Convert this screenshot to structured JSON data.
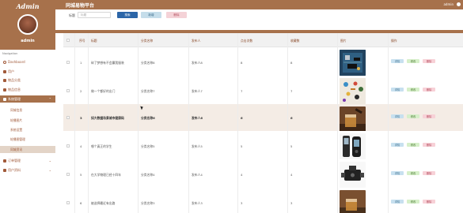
{
  "brand": "Admin",
  "header": {
    "title": "同城易物平台",
    "user": "admin"
  },
  "sidebar": {
    "admin_name": "admin",
    "nav_title": "Navigation",
    "items": [
      {
        "label": "Dashboard",
        "icon": "dashboard-icon"
      },
      {
        "label": "用户",
        "icon": "user-icon"
      },
      {
        "label": "物品分类",
        "icon": "category-icon"
      },
      {
        "label": "物品信息",
        "icon": "goods-icon"
      },
      {
        "label": "系统管理",
        "icon": "system-icon"
      },
      {
        "label": "订单管理",
        "icon": "order-icon"
      },
      {
        "label": "用户资料",
        "icon": "profile-icon"
      }
    ],
    "subitems": [
      "同城信息",
      "轮播图片",
      "系统设置",
      "轮播图管理",
      "同城资讯"
    ]
  },
  "search": {
    "label": "标题",
    "placeholder": "标题",
    "search_btn": "搜索",
    "add_btn": "新增",
    "delete_btn": "删除"
  },
  "table": {
    "headers": [
      "序号",
      "标题",
      "分类名称",
      "发布人",
      "点击次数",
      "收藏数",
      "图片",
      "操作"
    ],
    "rows": [
      {
        "no": "1",
        "title": "碎了梦想有不会赢我服装",
        "category": "分类名称8",
        "publisher": "发布人8",
        "clicks": "8",
        "favs": "8",
        "image": "circuit-board"
      },
      {
        "no": "2",
        "title": "做一个都好的出门",
        "category": "分类名称7",
        "publisher": "发布人7",
        "clicks": "7",
        "favs": "7",
        "image": "electronic-components"
      },
      {
        "no": "3",
        "title": "如大数据场景城市健康码",
        "category": "分类名称6",
        "publisher": "发布人6",
        "clicks": "6",
        "favs": "6",
        "image": "whisky-glass"
      },
      {
        "no": "4",
        "title": "哪个真正的学生",
        "category": "分类名称5",
        "publisher": "发布人5",
        "clicks": "5",
        "favs": "5",
        "image": "glucose-meter"
      },
      {
        "no": "5",
        "title": "在大学物理已经十四年",
        "category": "分类名称4",
        "publisher": "发布人4",
        "clicks": "4",
        "favs": "4",
        "image": "valve-device"
      },
      {
        "no": "6",
        "title": "被选择最近有出路",
        "category": "分类名称3",
        "publisher": "发布人3",
        "clicks": "3",
        "favs": "3",
        "image": "whisky-glass"
      }
    ],
    "ops": {
      "detail": "详情",
      "edit": "修改",
      "delete": "删除"
    }
  }
}
